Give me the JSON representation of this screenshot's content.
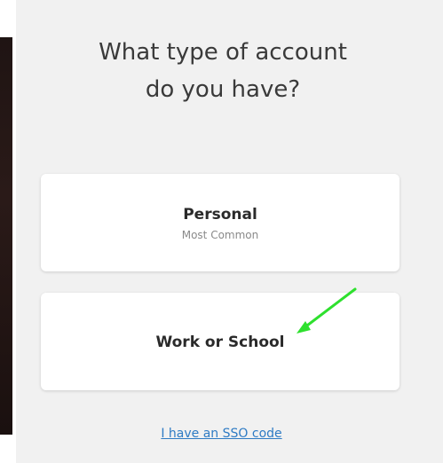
{
  "screen": {
    "title": "What type of account do you have?"
  },
  "options": {
    "personal": {
      "label": "Personal",
      "sublabel": "Most Common"
    },
    "work": {
      "label": "Work or School"
    }
  },
  "links": {
    "sso": "I have an SSO code"
  },
  "annotation": {
    "icon": "arrow-icon",
    "color": "#2ee02e"
  },
  "colors": {
    "panel_bg": "#f1f1f1",
    "card_bg": "#ffffff",
    "link": "#2e7bc4"
  }
}
